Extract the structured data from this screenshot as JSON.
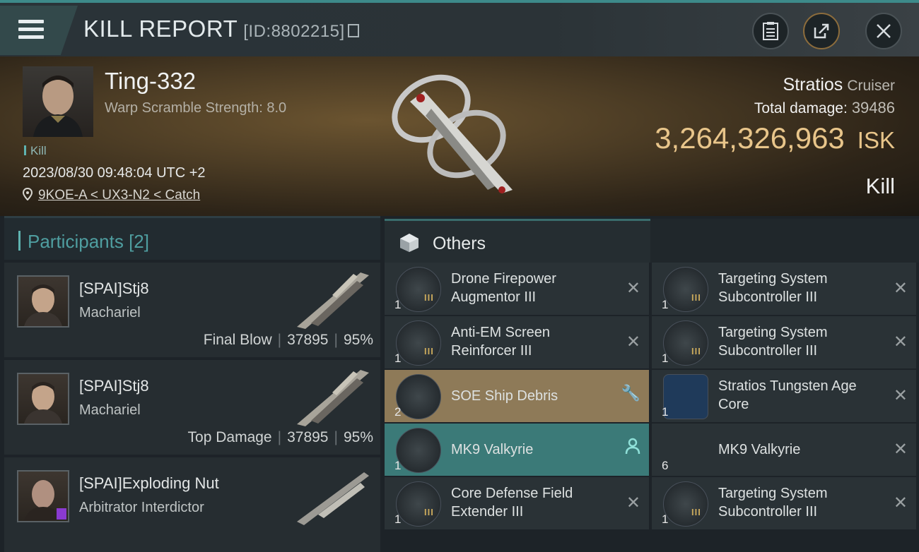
{
  "header": {
    "title": "KILL REPORT",
    "report_id": "[ID:8802215]"
  },
  "victim": {
    "name": "Ting-332",
    "detail": "Warp Scramble Strength: 8.0",
    "tag": "Kill",
    "datetime": "2023/08/30 09:48:04 UTC +2",
    "location": "9KOE-A < UX3-N2 < Catch",
    "ship": "Stratios",
    "ship_class": "Cruiser",
    "damage_label": "Total damage:",
    "damage_value": "39486",
    "isk_value": "3,264,326,963",
    "isk_unit": "ISK",
    "result": "Kill"
  },
  "participants": {
    "label": "Participants",
    "count": "[2]",
    "rows": [
      {
        "name": "[SPAI]Stj8",
        "ship": "Machariel",
        "stat_label": "Final Blow",
        "damage": "37895",
        "percent": "95%"
      },
      {
        "name": "[SPAI]Stj8",
        "ship": "Machariel",
        "stat_label": "Top Damage",
        "damage": "37895",
        "percent": "95%"
      },
      {
        "name": "[SPAI]Exploding Nut",
        "ship": "Arbitrator Interdictor",
        "stat_label": "",
        "damage": "",
        "percent": ""
      }
    ]
  },
  "others": {
    "title": "Others",
    "items": [
      {
        "name": "Drone Firepower Augmentor III",
        "qty": "1",
        "tier": "III",
        "state": "destroyed"
      },
      {
        "name": "Targeting System Subcontroller III",
        "qty": "1",
        "tier": "III",
        "state": "destroyed"
      },
      {
        "name": "Anti-EM Screen Reinforcer III",
        "qty": "1",
        "tier": "III",
        "state": "destroyed"
      },
      {
        "name": "Targeting System Subcontroller III",
        "qty": "1",
        "tier": "III",
        "state": "destroyed"
      },
      {
        "name": "SOE Ship Debris",
        "qty": "2",
        "tier": "",
        "state": "dropped"
      },
      {
        "name": "Stratios Tungsten Age Core",
        "qty": "1",
        "tier": "",
        "state": "destroyed"
      },
      {
        "name": "MK9  Valkyrie",
        "qty": "1",
        "tier": "",
        "state": "selected"
      },
      {
        "name": "MK9  Valkyrie",
        "qty": "6",
        "tier": "",
        "state": "destroyed"
      },
      {
        "name": "Core Defense Field Extender III",
        "qty": "1",
        "tier": "III",
        "state": "destroyed"
      },
      {
        "name": "Targeting System Subcontroller III",
        "qty": "1",
        "tier": "III",
        "state": "destroyed"
      }
    ]
  },
  "colors": {
    "accent": "#5fb3b0",
    "isk": "#e8c58a",
    "dropped": "#8e7a58",
    "selected": "#3b7a78"
  }
}
